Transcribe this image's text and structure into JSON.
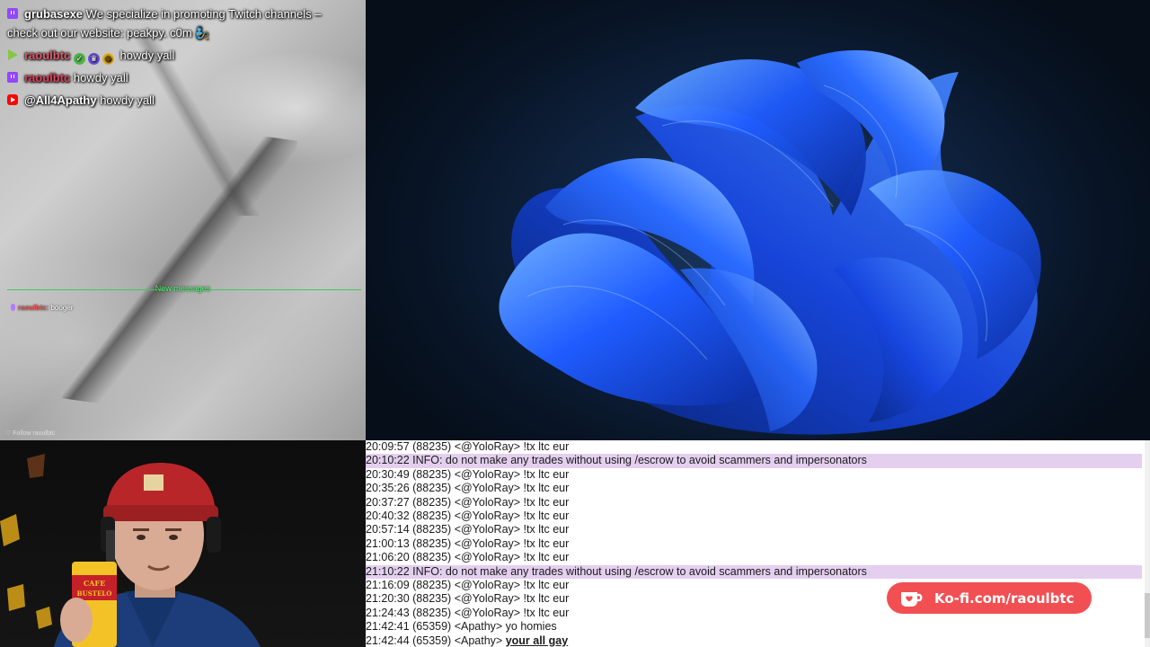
{
  "chat": {
    "messages": [
      {
        "platform": "twitch",
        "user": "grubasexe",
        "text": "We specialize in promoting Twitch channels – check out our website: peakpy. c0m 🧞",
        "user_color": "#ffffff"
      },
      {
        "platform": "rumble",
        "user": "raoulbtc",
        "text": "howdy yall",
        "user_color": "#e05a6a"
      },
      {
        "platform": "twitch",
        "user": "raoulbtc",
        "text": "howdy yall",
        "user_color": "#e0405a"
      },
      {
        "platform": "youtube",
        "user": "@All4Apathy",
        "text": "howdy yall",
        "user_color": "#ffffff"
      }
    ],
    "new_messages_label": "New messages",
    "mini_message": {
      "user": "raoulbtc:",
      "text": "booger"
    },
    "footer_credit": "♡ Follow raoulbtc"
  },
  "log": {
    "rows": [
      {
        "type": "msg",
        "text": "20:09:57 (88235) <@YoloRay> !tx ltc eur"
      },
      {
        "type": "info",
        "text": "20:10:22 INFO: do not make any trades without using /escrow to avoid scammers and impersonators"
      },
      {
        "type": "msg",
        "text": "20:30:49 (88235) <@YoloRay> !tx ltc eur"
      },
      {
        "type": "msg",
        "text": "20:35:26 (88235) <@YoloRay> !tx ltc eur"
      },
      {
        "type": "msg",
        "text": "20:37:27 (88235) <@YoloRay> !tx ltc eur"
      },
      {
        "type": "msg",
        "text": "20:40:32 (88235) <@YoloRay> !tx ltc eur"
      },
      {
        "type": "msg",
        "text": "20:57:14 (88235) <@YoloRay> !tx ltc eur"
      },
      {
        "type": "msg",
        "text": "21:00:13 (88235) <@YoloRay> !tx ltc eur"
      },
      {
        "type": "msg",
        "text": "21:06:20 (88235) <@YoloRay> !tx ltc eur"
      },
      {
        "type": "info",
        "text": "21:10:22 INFO: do not make any trades without using /escrow to avoid scammers and impersonators"
      },
      {
        "type": "msg",
        "text": "21:16:09 (88235) <@YoloRay> !tx ltc eur"
      },
      {
        "type": "msg",
        "text": "21:20:30 (88235) <@YoloRay> !tx ltc eur"
      },
      {
        "type": "msg",
        "text": "21:24:43 (88235) <@YoloRay> !tx ltc eur"
      },
      {
        "type": "msg",
        "text": "21:42:41 (65359) <Apathy> yo homies"
      },
      {
        "type": "msg",
        "prefix": "21:42:44 (65359) <Apathy> ",
        "bold": "your all gay"
      }
    ]
  },
  "kofi": {
    "label": "Ko-fi.com/raoulbtc"
  },
  "colors": {
    "kofi_red": "#f24f52",
    "info_highlight": "#e4cfef",
    "new_messages_green": "#3ec95a",
    "bloom_blue": "#1f5cff"
  }
}
